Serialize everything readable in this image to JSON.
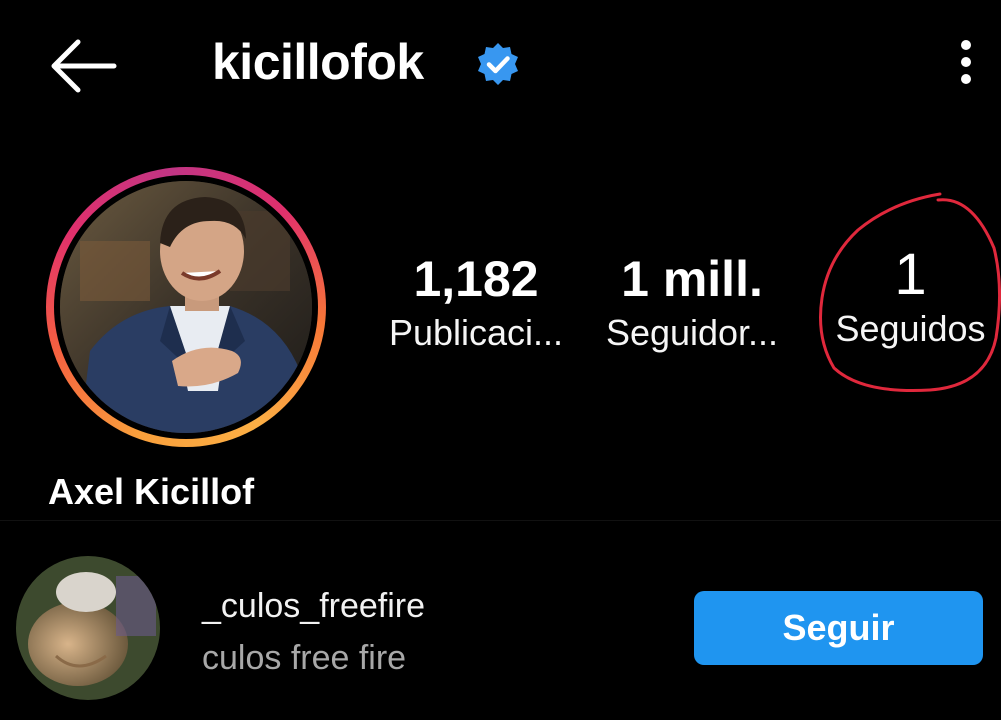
{
  "header": {
    "username": "kicillofok",
    "back_icon": "arrow-left-icon",
    "verified_icon": "verified-badge-icon",
    "menu_icon": "more-vertical-icon"
  },
  "profile": {
    "display_name": "Axel Kicillof",
    "stats": {
      "posts": {
        "value": "1,182",
        "label": "Publicaci..."
      },
      "followers": {
        "value": "1 mill.",
        "label": "Seguidor..."
      },
      "following": {
        "value": "1",
        "label": "Seguidos"
      }
    }
  },
  "suggestion": {
    "username": "_culos_freefire",
    "subtitle": "culos free fire",
    "follow_label": "Seguir"
  },
  "colors": {
    "background": "#000000",
    "follow_button": "#1f95f0",
    "verified_badge": "#3897f0",
    "annotation": "#e0283c"
  }
}
